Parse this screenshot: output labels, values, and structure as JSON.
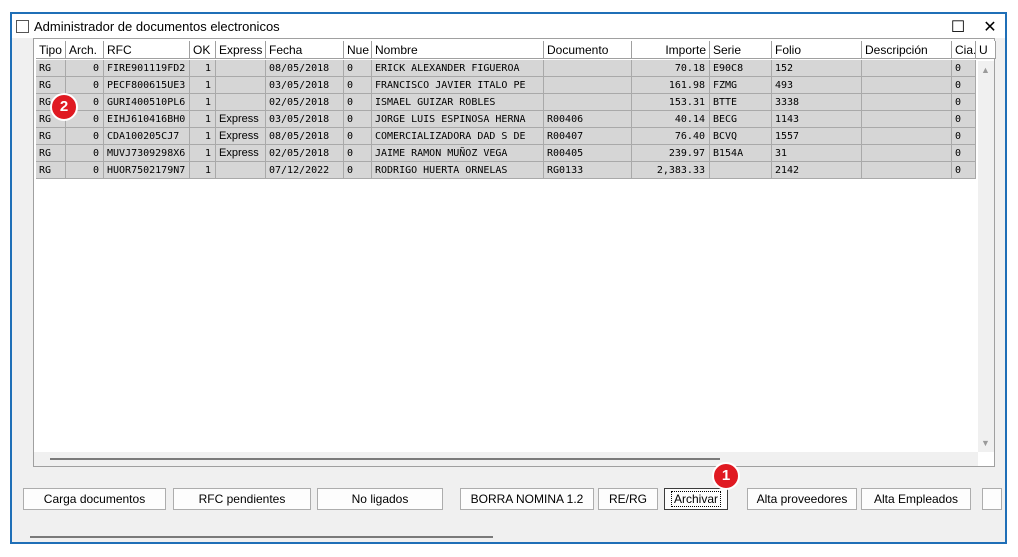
{
  "window": {
    "title": "Administrador de documentos electronicos",
    "maximize_glyph": "☐",
    "close_glyph": "✕"
  },
  "grid": {
    "columns": [
      "Tipo",
      "Arch.",
      "RFC",
      "OK",
      "Express",
      "Fecha",
      "Nue",
      "Nombre",
      "Documento",
      "Importe",
      "Serie",
      "Folio",
      "Descripción",
      "Cia.",
      "U"
    ],
    "rows": [
      [
        "RG",
        "0",
        "FIRE901119FD2",
        "1",
        "",
        "08/05/2018",
        "0",
        "ERICK ALEXANDER FIGUEROA",
        "",
        "70.18",
        "E90C8",
        "152",
        "",
        "0"
      ],
      [
        "RG",
        "0",
        "PECF800615UE3",
        "1",
        "",
        "03/05/2018",
        "0",
        "FRANCISCO JAVIER ITALO PE",
        "",
        "161.98",
        "FZMG",
        "493",
        "",
        "0"
      ],
      [
        "RG",
        "0",
        "GURI400510PL6",
        "1",
        "",
        "02/05/2018",
        "0",
        "ISMAEL GUIZAR ROBLES",
        "",
        "153.31",
        "BTTE",
        "3338",
        "",
        "0"
      ],
      [
        "RG",
        "0",
        "EIHJ610416BH0",
        "1",
        "Express",
        "03/05/2018",
        "0",
        "JORGE LUIS ESPINOSA HERNA",
        "R00406",
        "40.14",
        "BECG",
        "1143",
        "",
        "0"
      ],
      [
        "RG",
        "0",
        "CDA100205CJ7",
        "1",
        "Express",
        "08/05/2018",
        "0",
        "COMERCIALIZADORA DAD S DE",
        "R00407",
        "76.40",
        "BCVQ",
        "1557",
        "",
        "0"
      ],
      [
        "RG",
        "0",
        "MUVJ7309298X6",
        "1",
        "Express",
        "02/05/2018",
        "0",
        "JAIME RAMON MUÑOZ VEGA",
        "R00405",
        "239.97",
        "B154A",
        "31",
        "",
        "0"
      ],
      [
        "RG",
        "0",
        "HUOR7502179N7",
        "1",
        "",
        "07/12/2022",
        "0",
        "RODRIGO HUERTA ORNELAS",
        "RG0133",
        "2,383.33",
        "",
        "2142",
        "",
        "0"
      ]
    ],
    "scroll_up_glyph": "▲",
    "scroll_down_glyph": "▼"
  },
  "buttons": [
    {
      "name": "carga-documentos-button",
      "label": "Carga documentos"
    },
    {
      "name": "rfc-pendientes-button",
      "label": "RFC pendientes"
    },
    {
      "name": "no-ligados-button",
      "label": "No ligados"
    },
    {
      "name": "borra-nomina-button",
      "label": "BORRA NOMINA 1.2"
    },
    {
      "name": "re-rg-button",
      "label": "RE/RG"
    },
    {
      "name": "archivar-button",
      "label": "Archivar"
    },
    {
      "name": "alta-proveedores-button",
      "label": "Alta proveedores"
    },
    {
      "name": "alta-empleados-button",
      "label": "Alta Empleados"
    },
    {
      "name": "extra-button",
      "label": ""
    }
  ],
  "annotations": {
    "badge_1": "1",
    "badge_2": "2"
  },
  "colors": {
    "frame_border": "#1f6fb7",
    "badge": "#e01a22",
    "row_bg": "#d6d6d6"
  }
}
